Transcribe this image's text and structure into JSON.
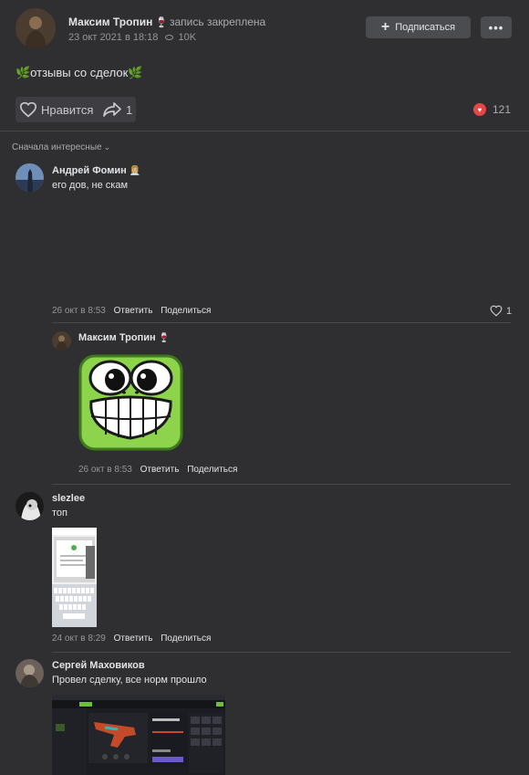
{
  "post": {
    "author": "Максим Тропин",
    "author_badge": "🍷",
    "pinned_label": "запись закреплена",
    "date": "23 окт 2021 в 18:18",
    "views": "10K",
    "subscribe_label": "Подписаться",
    "more_label": "•••",
    "text": "🌿отзывы со сделок🌿",
    "like_label": "Нравится",
    "share_count": "1",
    "reactions_count": "121"
  },
  "sort_label": "Сначала интересные",
  "comments": [
    {
      "author": "Андрей Фомин",
      "badge": "👩🏼‍💼",
      "text": "его дов, не скам",
      "date": "26 окт в 8:53",
      "reply_label": "Ответить",
      "share_label": "Поделиться",
      "likes": "1"
    },
    {
      "author": "Максим Тропин",
      "badge": "🍷",
      "text": "",
      "date": "26 окт в 8:53",
      "reply_label": "Ответить",
      "share_label": "Поделиться"
    },
    {
      "author": "slezlee",
      "text": "топ",
      "date": "24 окт в 8:29",
      "reply_label": "Ответить",
      "share_label": "Поделиться"
    },
    {
      "author": "Сергей Маховиков",
      "text": "Провел сделку, все норм прошло"
    }
  ],
  "colors": {
    "background": "#2f2f32",
    "button": "#4b4c50",
    "reaction_heart": "#e64646",
    "sticker_green": "#8dd34c"
  }
}
